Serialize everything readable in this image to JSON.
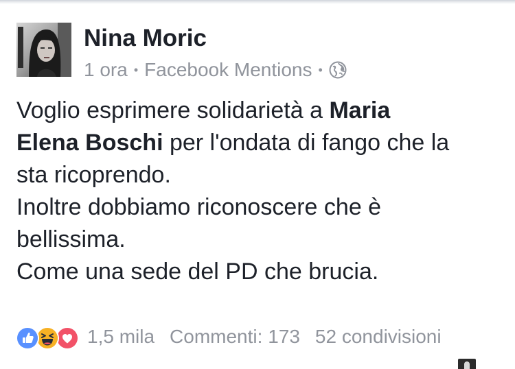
{
  "post": {
    "author": "Nina Moric",
    "time": "1 ora",
    "source": "Facebook Mentions",
    "privacy_icon": "globe-icon",
    "text": {
      "line1_a": "Voglio esprimere solidarietà a ",
      "line1_b": "Maria",
      "line2_a": "Elena Boschi",
      "line2_b": " per l'ondata di fango che la",
      "line3": "sta ricoprendo.",
      "line4": "Inoltre dobbiamo riconoscere che è",
      "line5": "bellissima.",
      "line6": "Come una sede del PD che brucia."
    }
  },
  "footer": {
    "reaction_icons": [
      "like-icon",
      "haha-icon",
      "love-icon"
    ],
    "reactions": "1,5 mila",
    "comments": "Commenti: 173",
    "shares": "52 condivisioni"
  },
  "colors": {
    "text": "#1d2129",
    "meta": "#90949c",
    "like": "#5890ff",
    "haha": "#f7b125",
    "love": "#f25268"
  }
}
